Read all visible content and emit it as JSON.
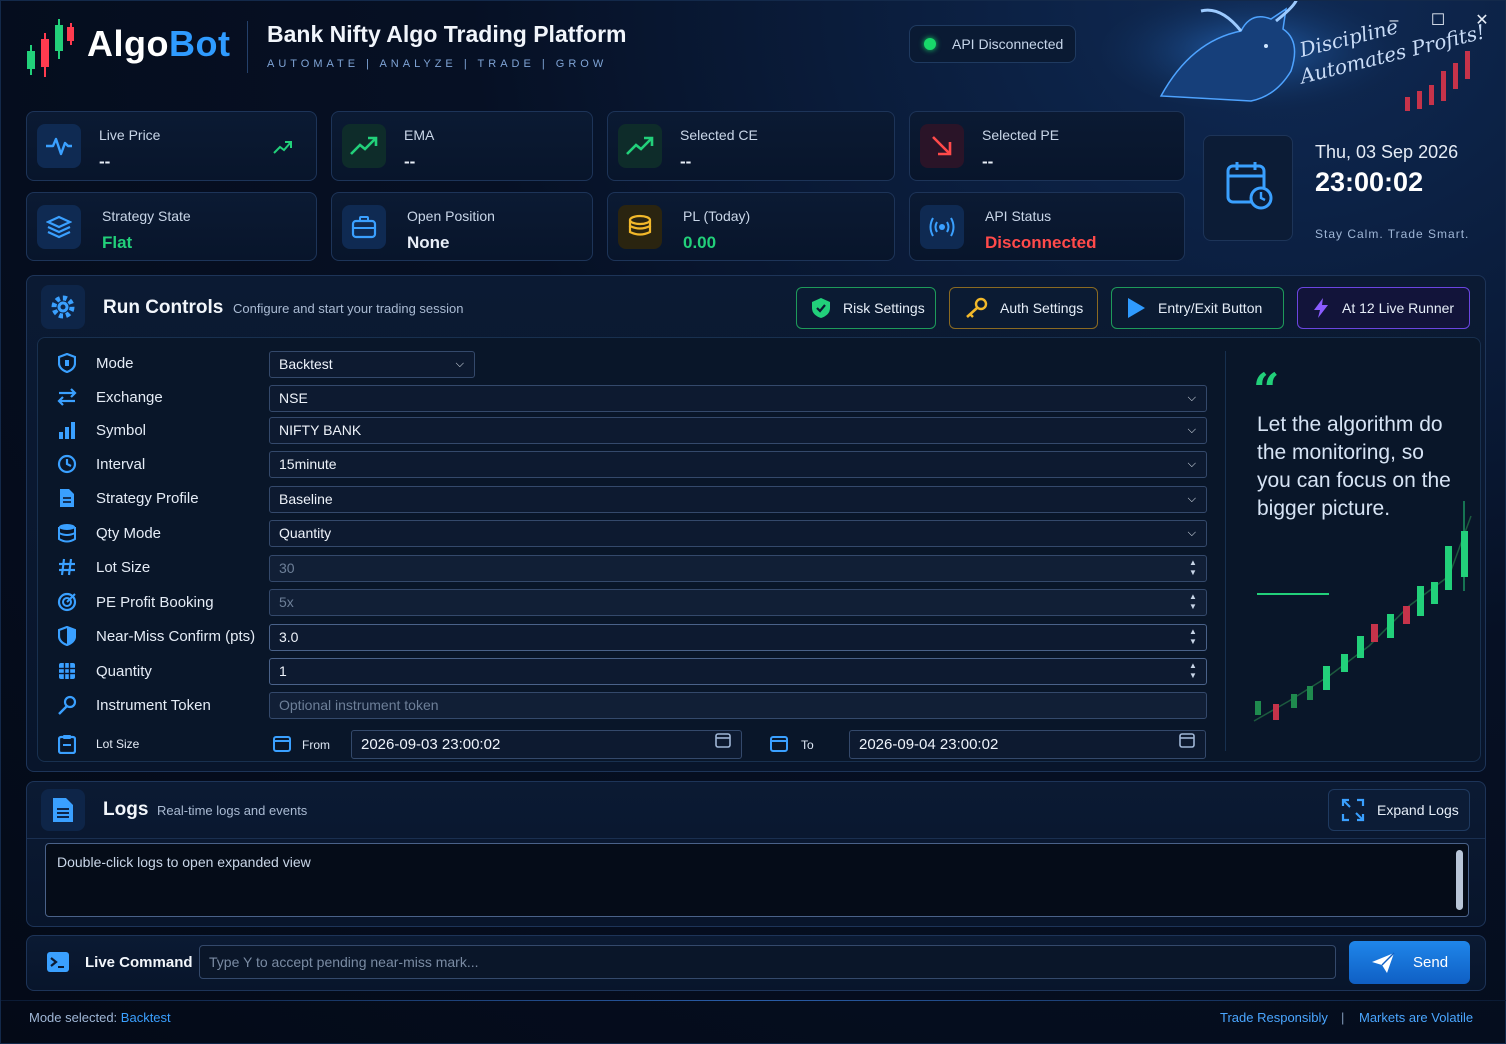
{
  "header": {
    "logo_algo": "Algo",
    "logo_bot": "Bot",
    "title": "Bank Nifty Algo Trading Platform",
    "tagline": "AUTOMATE | ANALYZE | TRADE | GROW",
    "api_pill": "API Disconnected",
    "motto_line1": "Discipline",
    "motto_line2": "Automates Profits!"
  },
  "cards": [
    {
      "label": "Live Price",
      "value": "--",
      "icon": "pulse-icon"
    },
    {
      "label": "EMA",
      "value": "--",
      "icon": "trend-up-icon"
    },
    {
      "label": "Selected CE",
      "value": "--",
      "icon": "trend-up-icon"
    },
    {
      "label": "Selected PE",
      "value": "--",
      "icon": "arrow-down-right-icon"
    },
    {
      "label": "Strategy State",
      "value": "Flat",
      "icon": "layers-icon"
    },
    {
      "label": "Open Position",
      "value": "None",
      "icon": "briefcase-icon"
    },
    {
      "label": "PL (Today)",
      "value": "0.00",
      "icon": "coins-icon"
    },
    {
      "label": "API Status",
      "value": "Disconnected",
      "icon": "broadcast-icon"
    }
  ],
  "clock": {
    "date": "Thu, 03 Sep 2026",
    "time": "23:00:02",
    "caption": "Stay Calm. Trade Smart."
  },
  "run_controls": {
    "title": "Run Controls",
    "subtitle": "Configure and start your trading session",
    "buttons": {
      "risk": "Risk Settings",
      "auth": "Auth Settings",
      "entry_exit": "Entry/Exit Button",
      "live_runner": "At 12 Live Runner"
    },
    "fields": {
      "mode": {
        "label": "Mode",
        "value": "Backtest"
      },
      "exchange": {
        "label": "Exchange",
        "value": "NSE"
      },
      "symbol": {
        "label": "Symbol",
        "value": "NIFTY BANK"
      },
      "interval": {
        "label": "Interval",
        "value": "15minute"
      },
      "strategy_profile": {
        "label": "Strategy Profile",
        "value": "Baseline"
      },
      "qty_mode": {
        "label": "Qty Mode",
        "value": "Quantity"
      },
      "lot_size": {
        "label": "Lot Size",
        "value": "30"
      },
      "pe_profit_booking": {
        "label": "PE Profit Booking",
        "value": "5x"
      },
      "near_miss": {
        "label": "Near-Miss Confirm (pts)",
        "value": "3.0"
      },
      "quantity": {
        "label": "Quantity",
        "value": "1"
      },
      "instrument_token": {
        "label": "Instrument Token",
        "placeholder": "Optional instrument token"
      },
      "date_row": {
        "label": "Lot Size",
        "from_label": "From",
        "from_value": "2026-09-03 23:00:02",
        "to_label": "To",
        "to_value": "2026-09-04 23:00:02"
      }
    },
    "quote": "Let the algorithm do the monitoring, so you can focus on the bigger picture."
  },
  "logs": {
    "title": "Logs",
    "subtitle": "Real-time logs and events",
    "expand": "Expand Logs",
    "content": "Double-click logs to open expanded view"
  },
  "command": {
    "label": "Live Command",
    "placeholder": "Type Y to accept pending near-miss mark...",
    "send": "Send"
  },
  "footer": {
    "mode_prefix": "Mode selected:",
    "mode_value": "Backtest",
    "right1": "Trade Responsibly",
    "sep": "|",
    "right2": "Markets are Volatile"
  },
  "colors": {
    "accent": "#2f9bff",
    "green": "#22d07a",
    "red": "#ff4a4a",
    "purple": "#7b4dff"
  }
}
